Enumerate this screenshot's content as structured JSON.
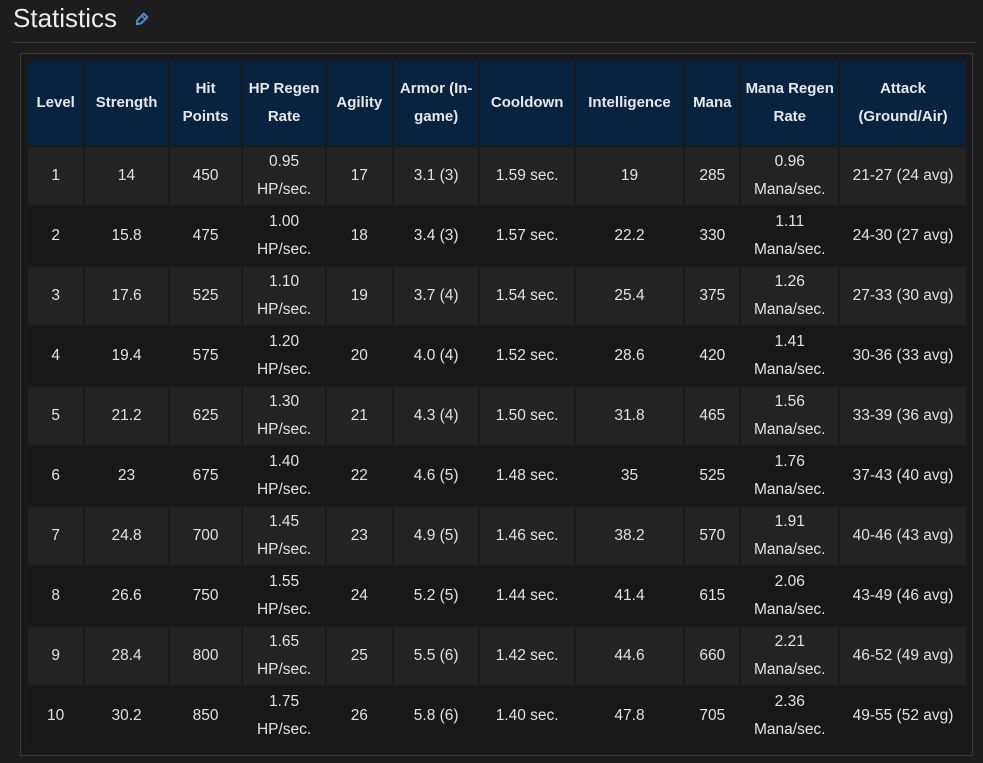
{
  "page": {
    "title": "Statistics",
    "edit_icon": "pencil-icon",
    "accent_color": "#4a8fd6",
    "header_bg": "#072340"
  },
  "table": {
    "headers": [
      "Level",
      "Strength",
      "Hit Points",
      "HP Regen Rate",
      "Agility",
      "Armor (In-game)",
      "Cooldown",
      "Intelligence",
      "Mana",
      "Mana Regen Rate",
      "Attack (Ground/Air)"
    ],
    "rows": [
      [
        "1",
        "14",
        "450",
        "0.95 HP/sec.",
        "17",
        "3.1 (3)",
        "1.59 sec.",
        "19",
        "285",
        "0.96 Mana/sec.",
        "21-27 (24 avg)"
      ],
      [
        "2",
        "15.8",
        "475",
        "1.00 HP/sec.",
        "18",
        "3.4 (3)",
        "1.57 sec.",
        "22.2",
        "330",
        "1.11 Mana/sec.",
        "24-30 (27 avg)"
      ],
      [
        "3",
        "17.6",
        "525",
        "1.10 HP/sec.",
        "19",
        "3.7 (4)",
        "1.54 sec.",
        "25.4",
        "375",
        "1.26 Mana/sec.",
        "27-33 (30 avg)"
      ],
      [
        "4",
        "19.4",
        "575",
        "1.20 HP/sec.",
        "20",
        "4.0 (4)",
        "1.52 sec.",
        "28.6",
        "420",
        "1.41 Mana/sec.",
        "30-36 (33 avg)"
      ],
      [
        "5",
        "21.2",
        "625",
        "1.30 HP/sec.",
        "21",
        "4.3 (4)",
        "1.50 sec.",
        "31.8",
        "465",
        "1.56 Mana/sec.",
        "33-39 (36 avg)"
      ],
      [
        "6",
        "23",
        "675",
        "1.40 HP/sec.",
        "22",
        "4.6 (5)",
        "1.48 sec.",
        "35",
        "525",
        "1.76 Mana/sec.",
        "37-43 (40 avg)"
      ],
      [
        "7",
        "24.8",
        "700",
        "1.45 HP/sec.",
        "23",
        "4.9 (5)",
        "1.46 sec.",
        "38.2",
        "570",
        "1.91 Mana/sec.",
        "40-46 (43 avg)"
      ],
      [
        "8",
        "26.6",
        "750",
        "1.55 HP/sec.",
        "24",
        "5.2 (5)",
        "1.44 sec.",
        "41.4",
        "615",
        "2.06 Mana/sec.",
        "43-49 (46 avg)"
      ],
      [
        "9",
        "28.4",
        "800",
        "1.65 HP/sec.",
        "25",
        "5.5 (6)",
        "1.42 sec.",
        "44.6",
        "660",
        "2.21 Mana/sec.",
        "46-52 (49 avg)"
      ],
      [
        "10",
        "30.2",
        "850",
        "1.75 HP/sec.",
        "26",
        "5.8 (6)",
        "1.40 sec.",
        "47.8",
        "705",
        "2.36 Mana/sec.",
        "49-55 (52 avg)"
      ]
    ]
  }
}
